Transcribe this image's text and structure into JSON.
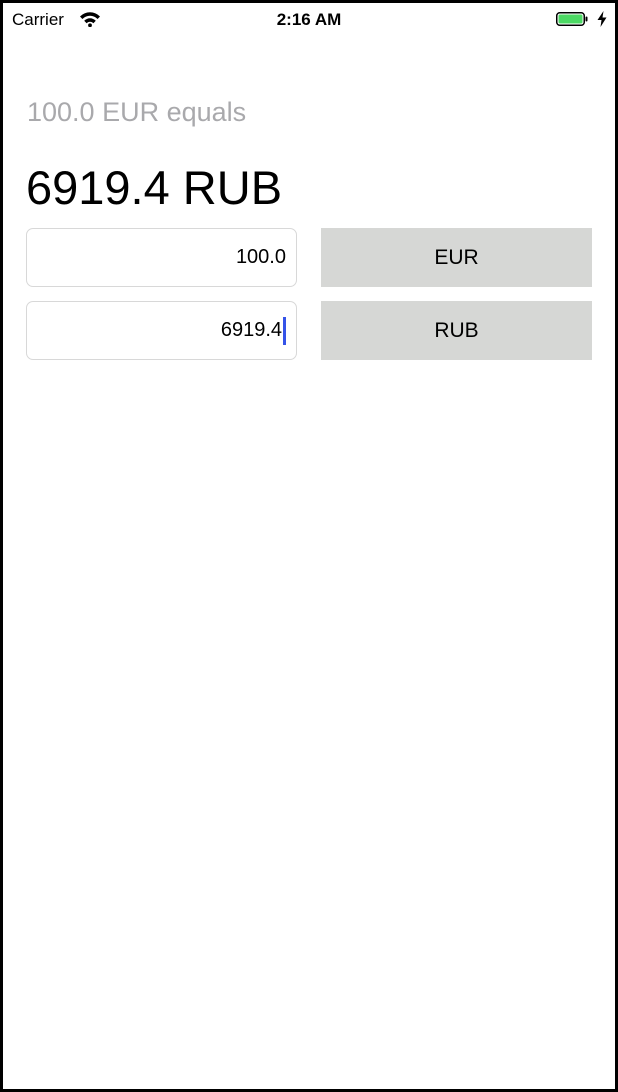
{
  "status_bar": {
    "carrier": "Carrier",
    "time": "2:16 AM",
    "battery_color": "#4cd964"
  },
  "converter": {
    "summary": "100.0 EUR equals",
    "result": "6919.4 RUB",
    "rows": [
      {
        "amount": "100.0",
        "currency": "EUR"
      },
      {
        "amount": "6919.4",
        "currency": "RUB"
      }
    ]
  },
  "colors": {
    "summary_text": "#a9a9ac",
    "button_bg": "#d6d7d5",
    "caret": "#3553e8"
  },
  "icons": {
    "wifi": "wifi-icon",
    "battery": "battery-icon",
    "charging": "charging-bolt-icon"
  }
}
